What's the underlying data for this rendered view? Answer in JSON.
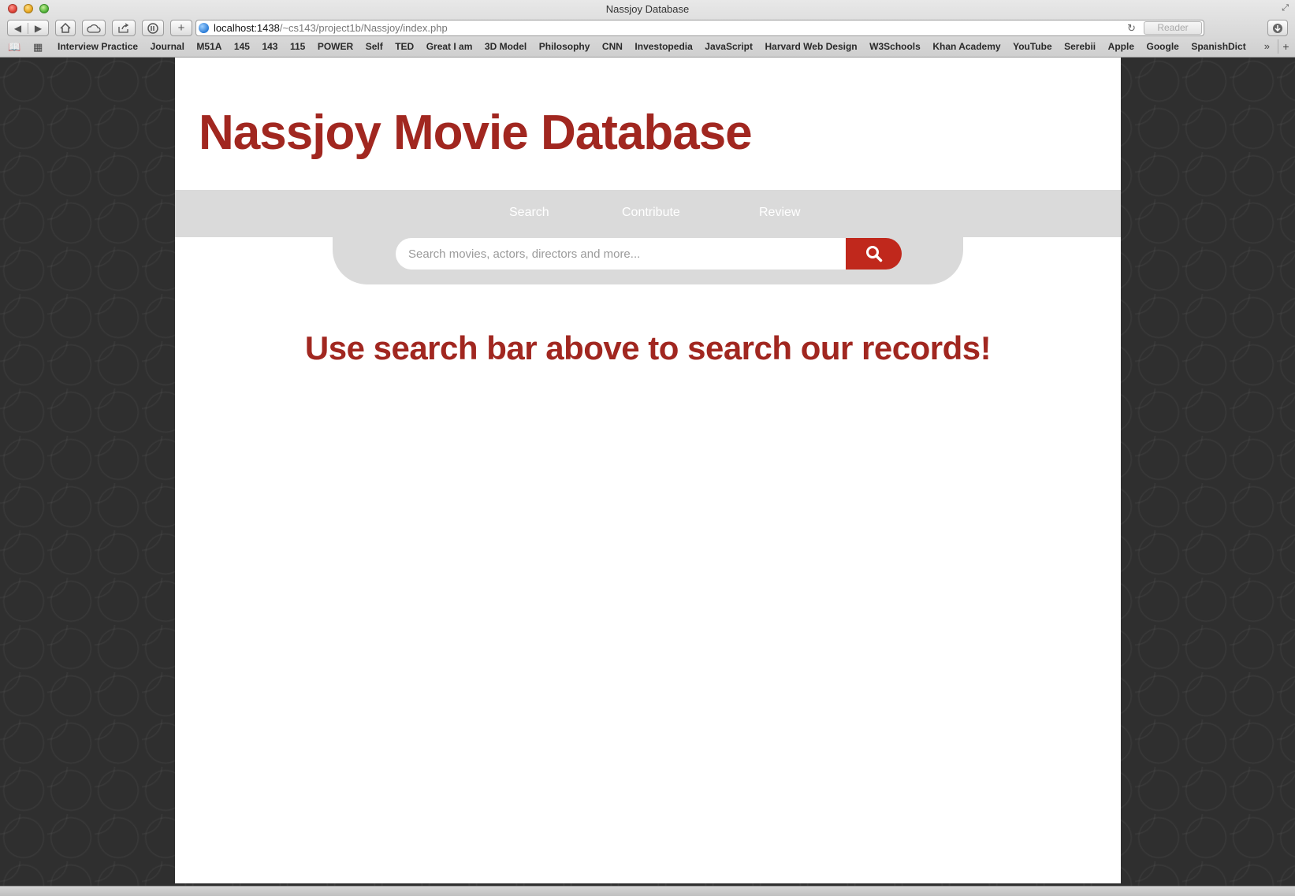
{
  "window": {
    "title": "Nassjoy Database"
  },
  "toolbar": {
    "back_icon": "◀",
    "forward_icon": "▶",
    "url_host": "localhost:1438",
    "url_path": "/~cs143/project1b/Nassjoy/index.php",
    "reader_label": "Reader"
  },
  "bookmarks": [
    "Interview Practice",
    "Journal",
    "M51A",
    "145",
    "143",
    "115",
    "POWER",
    "Self",
    "TED",
    "Great I am",
    "3D Model",
    "Philosophy",
    "CNN",
    "Investopedia",
    "JavaScript",
    "Harvard Web Design",
    "W3Schools",
    "Khan Academy",
    "YouTube",
    "Serebii",
    "Apple",
    "Google",
    "SpanishDict"
  ],
  "site": {
    "title": "Nassjoy Movie Database",
    "nav": {
      "search": "Search",
      "contribute": "Contribute",
      "review": "Review"
    },
    "search_placeholder": "Search movies, actors, directors and more...",
    "headline": "Use search bar above to search our records!"
  },
  "colors": {
    "brand_red": "#a12720",
    "button_red": "#c0281c",
    "nav_gray": "#dadada"
  }
}
